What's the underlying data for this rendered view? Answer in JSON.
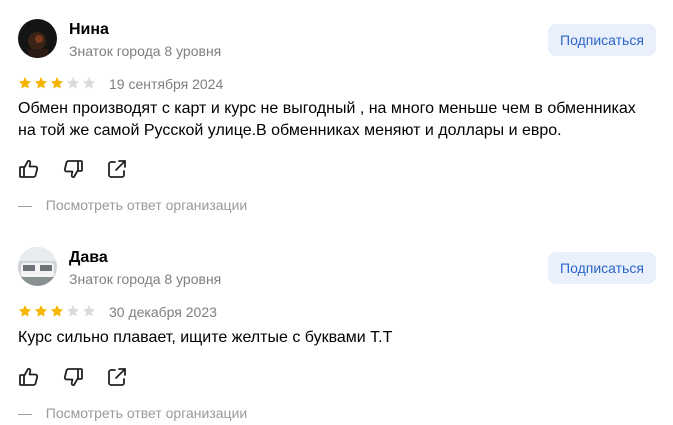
{
  "reviews": [
    {
      "author": "Нина",
      "level": "Знаток города 8 уровня",
      "subscribe_label": "Подписаться",
      "rating": 3,
      "rating_max": 5,
      "date": "19 сентября 2024",
      "text_lines": [
        "Обмен производят с карт и курс не выгодный , на много меньше чем в обменниках",
        "на той же самой Русской улице.В обменниках меняют и доллары и евро."
      ],
      "response_prefix": "—",
      "response_label": "Посмотреть ответ организации"
    },
    {
      "author": "Дава",
      "level": "Знаток города 8 уровня",
      "subscribe_label": "Подписаться",
      "rating": 3,
      "rating_max": 5,
      "date": "30 декабря 2023",
      "text_lines": [
        "Курс сильно плавает, ищите желтые с буквами Т.Т"
      ],
      "response_prefix": "—",
      "response_label": "Посмотреть ответ организации"
    }
  ],
  "icons": {
    "like": "thumbs-up-icon",
    "dislike": "thumbs-down-icon",
    "share": "share-icon",
    "star": "star-icon"
  },
  "colors": {
    "star_filled": "#f6b500",
    "star_empty": "#dcdcdc",
    "accent": "#2a65c9",
    "accent_bg": "#eaf0fb",
    "secondary_text": "#7f7f7f"
  }
}
